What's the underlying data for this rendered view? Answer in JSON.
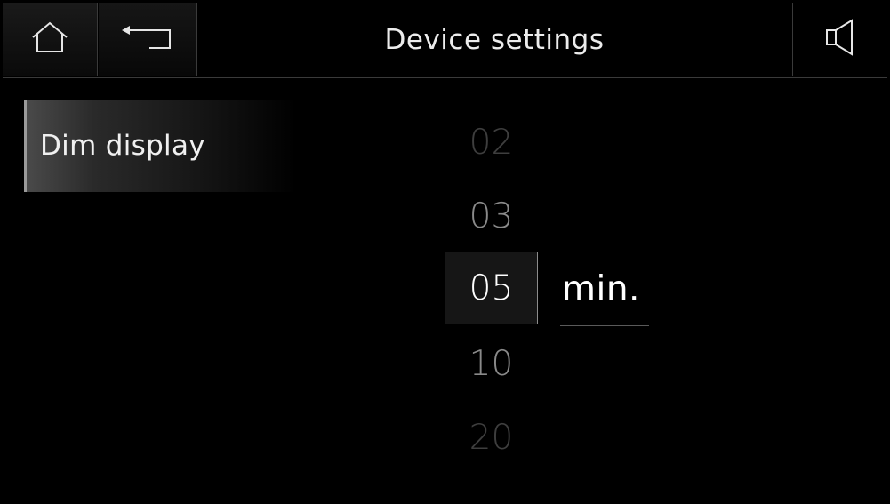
{
  "header": {
    "title": "Device settings",
    "home_icon": "home-icon",
    "back_icon": "back-arrow-icon",
    "sound_icon": "speaker-icon"
  },
  "menu": {
    "items": [
      {
        "label": "Dim display",
        "selected": true
      }
    ]
  },
  "picker": {
    "values": [
      "02",
      "03",
      "05",
      "10",
      "20"
    ],
    "selected": "05",
    "unit": "min."
  },
  "colors": {
    "background": "#000000",
    "text": "#e8e8e8",
    "selected_border": "#8c8c8c",
    "dim_value": "#8a8a8a",
    "faint_value": "#3e3e3e"
  }
}
